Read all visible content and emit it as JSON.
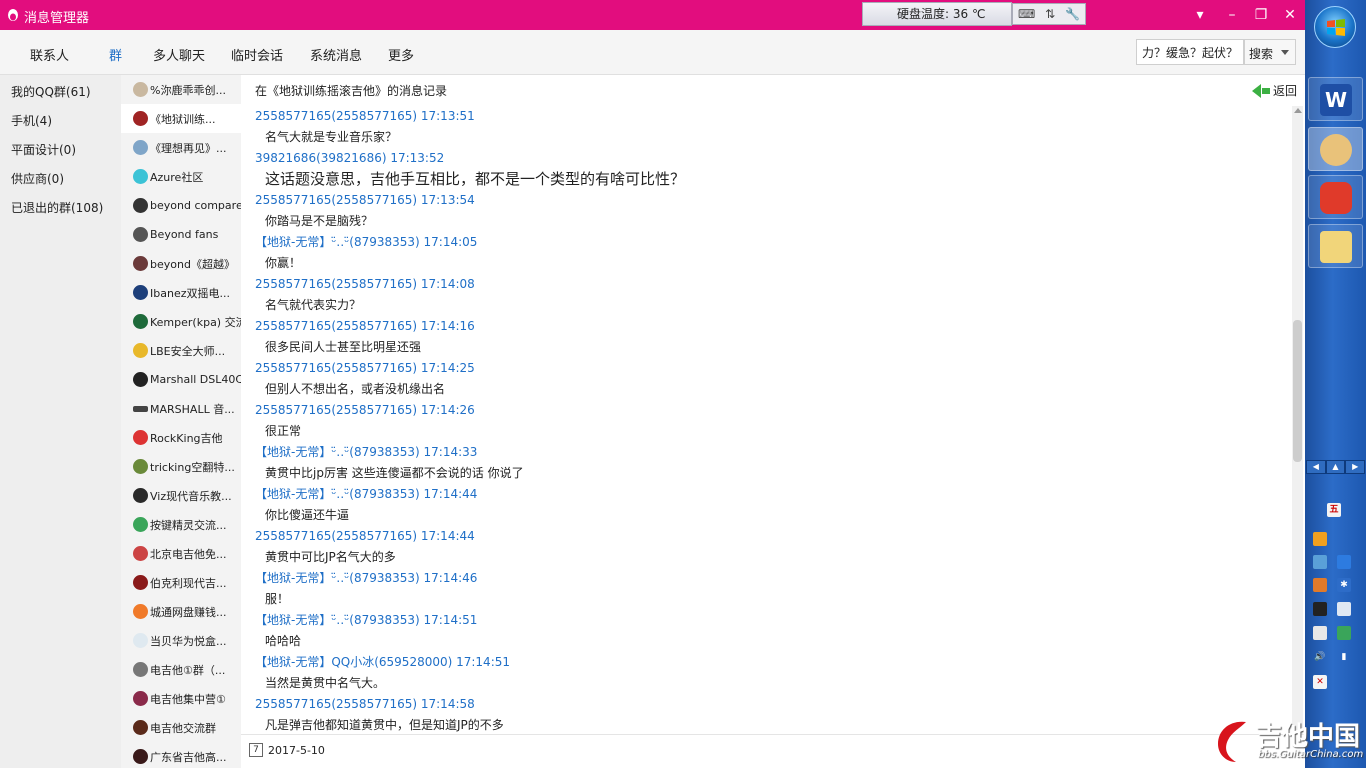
{
  "window": {
    "title": "消息管理器",
    "disk_temp": "硬盘温度: 36 ℃"
  },
  "nav": {
    "tabs": [
      "联系人",
      "群",
      "多人聊天",
      "临时会话",
      "系统消息",
      "更多"
    ],
    "active_tab": "群",
    "search_value": "力？缓急？起伏？",
    "search_button": "搜索"
  },
  "categories": [
    "我的QQ群(61)",
    "手机(4)",
    "平面设计(0)",
    "供应商(0)",
    "已退出的群(108)"
  ],
  "groups": [
    "%沵鹿乖乖创...",
    "《地狱训练...",
    "《理想再见》...",
    "Azure社区",
    "beyond compare",
    "Beyond fans",
    "beyond《超越》",
    "Ibanez双摇电...",
    "Kemper(kpa) 交流",
    "LBE安全大师...",
    "Marshall DSL40C",
    "MARSHALL 音...",
    "RockKing吉他",
    "tricking空翻特...",
    "Viz现代音乐教...",
    "按键精灵交流...",
    "北京电吉他免...",
    "伯克利现代吉...",
    "城通网盘赚钱...",
    "当贝华为悦盒...",
    "电吉他①群（...",
    "电吉他集中营①",
    "电吉他交流群",
    "广东省吉他高..."
  ],
  "conversation": {
    "header": "在《地狱训练摇滚吉他》的消息记录",
    "back_label": "返回",
    "date": "2017-5-10",
    "messages": [
      {
        "meta": "2558577165(2558577165) 17:13:51",
        "text": "名气大就是专业音乐家？"
      },
      {
        "meta": "39821686(39821686) 17:13:52",
        "text": "这话题没意思，吉他手互相比，都不是一个类型的有啥可比性？"
      },
      {
        "meta": "2558577165(2558577165) 17:13:54",
        "text": "你踏马是不是脑残？"
      },
      {
        "meta": "【地狱-无常】ᵕ̈‥ᵕ̈(87938353) 17:14:05",
        "text": "你赢！"
      },
      {
        "meta": "2558577165(2558577165) 17:14:08",
        "text": "名气就代表实力？"
      },
      {
        "meta": "2558577165(2558577165) 17:14:16",
        "text": "很多民间人士甚至比明星还强"
      },
      {
        "meta": "2558577165(2558577165) 17:14:25",
        "text": "但别人不想出名，或者没机缘出名"
      },
      {
        "meta": "2558577165(2558577165) 17:14:26",
        "text": "很正常"
      },
      {
        "meta": "【地狱-无常】ᵕ̈‥ᵕ̈(87938353) 17:14:33",
        "text": "黄贯中比jp厉害 这些连傻逼都不会说的话 你说了"
      },
      {
        "meta": "【地狱-无常】ᵕ̈‥ᵕ̈(87938353) 17:14:44",
        "text": "你比傻逼还牛逼"
      },
      {
        "meta": "2558577165(2558577165) 17:14:44",
        "text": "黄贯中可比JP名气大的多"
      },
      {
        "meta": "【地狱-无常】ᵕ̈‥ᵕ̈(87938353) 17:14:46",
        "text": "服！"
      },
      {
        "meta": "【地狱-无常】ᵕ̈‥ᵕ̈(87938353) 17:14:51",
        "text": "哈哈哈"
      },
      {
        "meta": "【地狱-无常】QQ小冰(659528000) 17:14:51",
        "text": "当然是黄贯中名气大。"
      },
      {
        "meta": "2558577165(2558577165) 17:14:58",
        "text": "凡是弹吉他都知道黄贯中，但是知道JP的不多"
      }
    ]
  },
  "taskbar": {
    "ime_label": "五"
  },
  "watermark": {
    "title": "吉他中国",
    "subtitle": "bbs.GuitarChina.com"
  },
  "colors": {
    "title_bar": "#e20d7e",
    "accent": "#1f6fc7",
    "taskbar": "#2c6cc8"
  }
}
